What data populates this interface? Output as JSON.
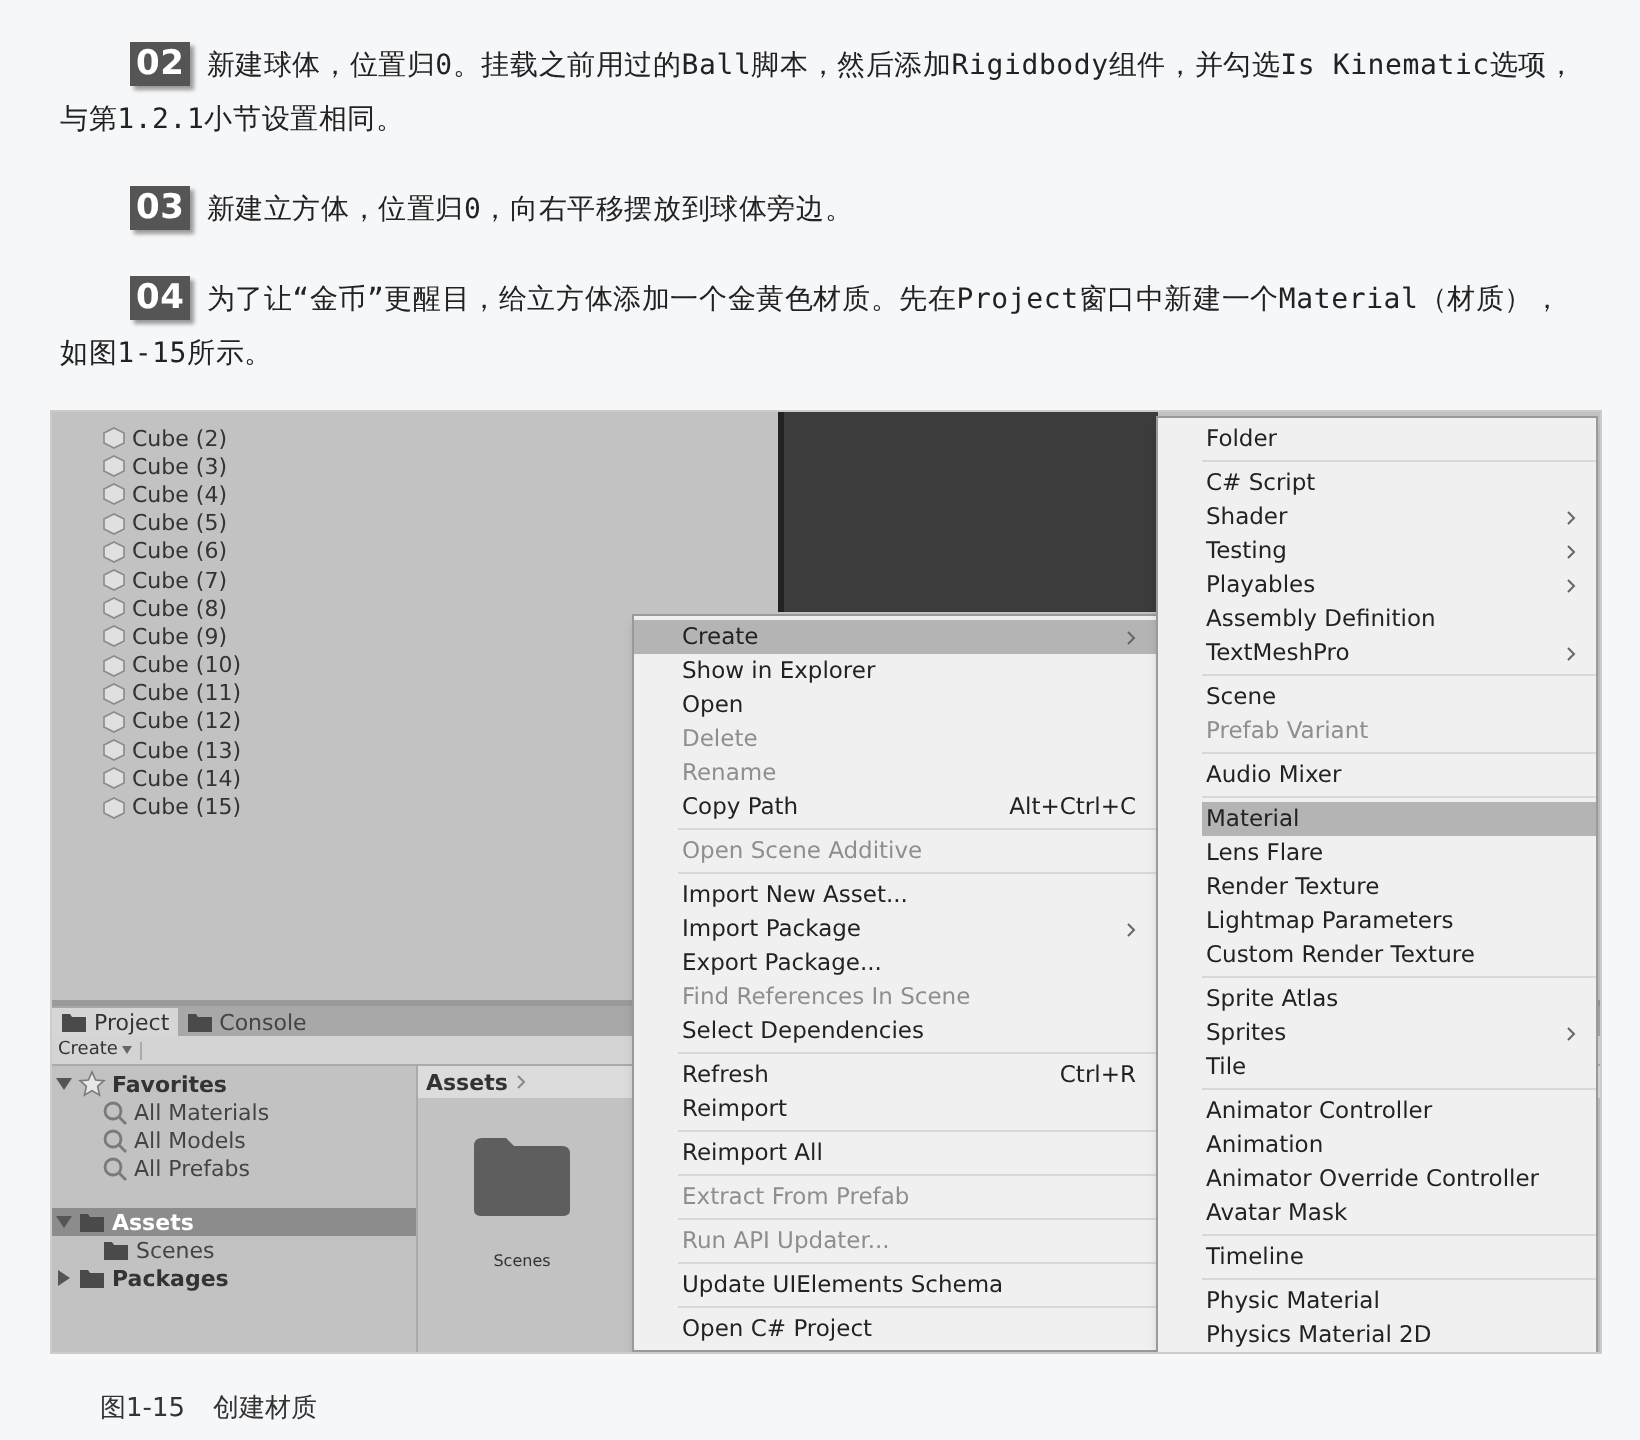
{
  "steps": [
    {
      "number": "02",
      "text": "新建球体，位置归0。挂载之前用过的Ball脚本，然后添加Rigidbody组件，并勾选Is Kinematic选项，与第1.2.1小节设置相同。"
    },
    {
      "number": "03",
      "text": "新建立方体，位置归0，向右平移摆放到球体旁边。"
    },
    {
      "number": "04",
      "text": "为了让“金币”更醒目，给立方体添加一个金黄色材质。先在Project窗口中新建一个Material（材质），如图1-15所示。"
    }
  ],
  "figure": {
    "hierarchy": {
      "items": [
        "Cube (2)",
        "Cube (3)",
        "Cube (4)",
        "Cube (5)",
        "Cube (6)",
        "Cube (7)",
        "Cube (8)",
        "Cube (9)",
        "Cube (10)",
        "Cube (11)",
        "Cube (12)",
        "Cube (13)",
        "Cube (14)",
        "Cube (15)"
      ]
    },
    "project_panel": {
      "tabs": [
        {
          "label": "Project",
          "selected": true
        },
        {
          "label": "Console",
          "selected": false
        }
      ],
      "create_button": "Create",
      "tree": [
        {
          "label": "Favorites",
          "kind": "favorites",
          "expanded": true,
          "selected": false,
          "children": [
            {
              "label": "All Materials",
              "kind": "search",
              "selected": false
            },
            {
              "label": "All Models",
              "kind": "search",
              "selected": false
            },
            {
              "label": "All Prefabs",
              "kind": "search",
              "selected": false
            }
          ]
        },
        {
          "label": "Assets",
          "kind": "folder",
          "expanded": true,
          "selected": true,
          "children": [
            {
              "label": "Scenes",
              "kind": "folder",
              "selected": false
            }
          ]
        },
        {
          "label": "Packages",
          "kind": "folder",
          "expanded": false,
          "selected": false
        }
      ],
      "breadcrumb": "Assets",
      "folders": [
        {
          "label": "Scenes"
        }
      ]
    },
    "context_menu": {
      "sections": [
        [
          {
            "label": "Create",
            "submenu": true,
            "disabled": false,
            "selected": true
          },
          {
            "label": "Show in Explorer",
            "submenu": false,
            "disabled": false,
            "selected": false
          },
          {
            "label": "Open",
            "submenu": false,
            "disabled": false,
            "selected": false
          },
          {
            "label": "Delete",
            "submenu": false,
            "disabled": true,
            "selected": false
          },
          {
            "label": "Rename",
            "submenu": false,
            "disabled": true,
            "selected": false
          },
          {
            "label": "Copy Path",
            "shortcut": "Alt+Ctrl+C",
            "submenu": false,
            "disabled": false,
            "selected": false
          }
        ],
        [
          {
            "label": "Open Scene Additive",
            "submenu": false,
            "disabled": true,
            "selected": false
          }
        ],
        [
          {
            "label": "Import New Asset...",
            "submenu": false,
            "disabled": false,
            "selected": false
          },
          {
            "label": "Import Package",
            "submenu": true,
            "disabled": false,
            "selected": false
          },
          {
            "label": "Export Package...",
            "submenu": false,
            "disabled": false,
            "selected": false
          },
          {
            "label": "Find References In Scene",
            "submenu": false,
            "disabled": true,
            "selected": false
          },
          {
            "label": "Select Dependencies",
            "submenu": false,
            "disabled": false,
            "selected": false
          }
        ],
        [
          {
            "label": "Refresh",
            "shortcut": "Ctrl+R",
            "submenu": false,
            "disabled": false,
            "selected": false
          },
          {
            "label": "Reimport",
            "submenu": false,
            "disabled": false,
            "selected": false
          }
        ],
        [
          {
            "label": "Reimport All",
            "submenu": false,
            "disabled": false,
            "selected": false
          }
        ],
        [
          {
            "label": "Extract From Prefab",
            "submenu": false,
            "disabled": true,
            "selected": false
          }
        ],
        [
          {
            "label": "Run API Updater...",
            "submenu": false,
            "disabled": true,
            "selected": false
          }
        ],
        [
          {
            "label": "Update UIElements Schema",
            "submenu": false,
            "disabled": false,
            "selected": false
          }
        ],
        [
          {
            "label": "Open C# Project",
            "submenu": false,
            "disabled": false,
            "selected": false
          }
        ]
      ]
    },
    "create_submenu": {
      "sections": [
        [
          {
            "label": "Folder",
            "submenu": false,
            "disabled": false,
            "selected": false
          }
        ],
        [
          {
            "label": "C# Script",
            "submenu": false,
            "disabled": false,
            "selected": false
          },
          {
            "label": "Shader",
            "submenu": true,
            "disabled": false,
            "selected": false
          },
          {
            "label": "Testing",
            "submenu": true,
            "disabled": false,
            "selected": false
          },
          {
            "label": "Playables",
            "submenu": true,
            "disabled": false,
            "selected": false
          },
          {
            "label": "Assembly Definition",
            "submenu": false,
            "disabled": false,
            "selected": false
          },
          {
            "label": "TextMeshPro",
            "submenu": true,
            "disabled": false,
            "selected": false
          }
        ],
        [
          {
            "label": "Scene",
            "submenu": false,
            "disabled": false,
            "selected": false
          },
          {
            "label": "Prefab Variant",
            "submenu": false,
            "disabled": true,
            "selected": false
          }
        ],
        [
          {
            "label": "Audio Mixer",
            "submenu": false,
            "disabled": false,
            "selected": false
          }
        ],
        [
          {
            "label": "Material",
            "submenu": false,
            "disabled": false,
            "selected": true
          },
          {
            "label": "Lens Flare",
            "submenu": false,
            "disabled": false,
            "selected": false
          },
          {
            "label": "Render Texture",
            "submenu": false,
            "disabled": false,
            "selected": false
          },
          {
            "label": "Lightmap Parameters",
            "submenu": false,
            "disabled": false,
            "selected": false
          },
          {
            "label": "Custom Render Texture",
            "submenu": false,
            "disabled": false,
            "selected": false
          }
        ],
        [
          {
            "label": "Sprite Atlas",
            "submenu": false,
            "disabled": false,
            "selected": false
          },
          {
            "label": "Sprites",
            "submenu": true,
            "disabled": false,
            "selected": false
          },
          {
            "label": "Tile",
            "submenu": false,
            "disabled": false,
            "selected": false
          }
        ],
        [
          {
            "label": "Animator Controller",
            "submenu": false,
            "disabled": false,
            "selected": false
          },
          {
            "label": "Animation",
            "submenu": false,
            "disabled": false,
            "selected": false
          },
          {
            "label": "Animator Override Controller",
            "submenu": false,
            "disabled": false,
            "selected": false
          },
          {
            "label": "Avatar Mask",
            "submenu": false,
            "disabled": false,
            "selected": false
          }
        ],
        [
          {
            "label": "Timeline",
            "submenu": false,
            "disabled": false,
            "selected": false
          }
        ],
        [
          {
            "label": "Physic Material",
            "submenu": false,
            "disabled": false,
            "selected": false
          },
          {
            "label": "Physics Material 2D",
            "submenu": false,
            "disabled": false,
            "selected": false
          }
        ]
      ]
    }
  },
  "caption": {
    "number": "图1-15",
    "title": "创建材质"
  }
}
